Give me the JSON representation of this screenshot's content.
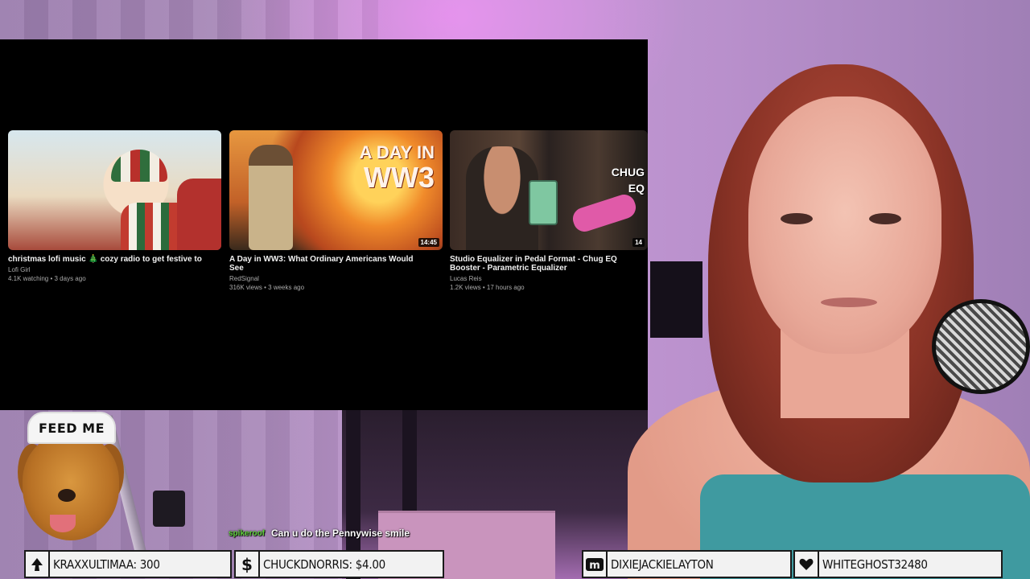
{
  "end_screen": {
    "videos": [
      {
        "title": "christmas lofi music 🎄 cozy radio to get festive to",
        "channel": "Lofi Girl",
        "meta": "4.1K watching • 3 days ago",
        "duration": ""
      },
      {
        "title": "A Day in WW3: What Ordinary Americans Would See",
        "channel": "RedSignal",
        "meta": "316K views • 3 weeks ago",
        "duration": "14:45",
        "thumb_text_line1": "A DAY IN",
        "thumb_text_line2": "WW3"
      },
      {
        "title": "Studio Equalizer in Pedal Format - Chug EQ Booster - Parametric Equalizer",
        "channel": "Lucas Reis",
        "meta": "1.2K views • 17 hours ago",
        "duration": "14",
        "thumb_text_line1": "CHUG",
        "thumb_text_line2": "EQ"
      }
    ]
  },
  "dog_alert": {
    "hat_text": "FEED ME"
  },
  "chat": {
    "username": "spikeroof",
    "message": "Can u do the Pennywise smile"
  },
  "event_bar": {
    "items": [
      {
        "icon": "spade-icon",
        "text": "KRAXXULTIMAA: 300"
      },
      {
        "icon": "dollar-icon",
        "text": "CHUCKDNORRIS: $4.00"
      },
      {
        "icon": "m-icon",
        "text": "DIXIEJACKIELAYTON"
      },
      {
        "icon": "heart-icon",
        "text": "WHITEGHOST32480"
      }
    ]
  },
  "colors": {
    "panel_bg": "#000000",
    "event_bg": "#f2f2f2",
    "chat_user": "#5fcf3a",
    "wall_purple": "#b48ac4"
  }
}
